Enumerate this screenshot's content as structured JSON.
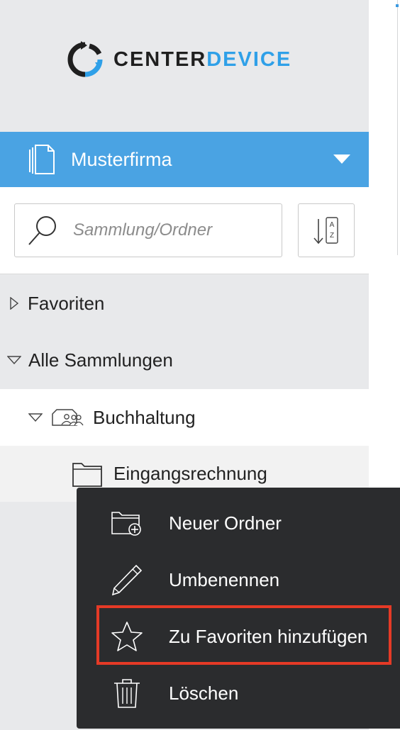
{
  "app": {
    "logo_part1": "CENTER",
    "logo_part2": "DEVICE",
    "brand_color": "#4aa3e3",
    "accent_text_color": "#2fa0e8"
  },
  "org_selector": {
    "name": "Musterfirma",
    "icon": "document-stack-icon",
    "caret_icon": "caret-down-icon"
  },
  "search": {
    "placeholder": "Sammlung/Ordner",
    "value": "",
    "icon": "search-icon"
  },
  "sort": {
    "icon": "sort-alpha-icon",
    "letter_top": "A",
    "letter_bottom": "Z"
  },
  "tree": {
    "favorites": {
      "label": "Favoriten",
      "expanded": false
    },
    "all_collections": {
      "label": "Alle Sammlungen",
      "expanded": true
    },
    "collection": {
      "label": "Buchhaltung",
      "icon": "shared-collection-icon",
      "expanded": true
    },
    "folder": {
      "label": "Eingangsrechnung",
      "icon": "folder-icon"
    }
  },
  "context_menu": {
    "background": "#2b2c2e",
    "items": [
      {
        "label": "Neuer Ordner",
        "icon": "new-folder-icon"
      },
      {
        "label": "Umbenennen",
        "icon": "pencil-icon"
      },
      {
        "label": "Zu Favoriten hinzufügen",
        "icon": "star-icon",
        "highlighted": true
      },
      {
        "label": "Löschen",
        "icon": "trash-icon"
      }
    ],
    "highlight_color": "#e53a26"
  }
}
